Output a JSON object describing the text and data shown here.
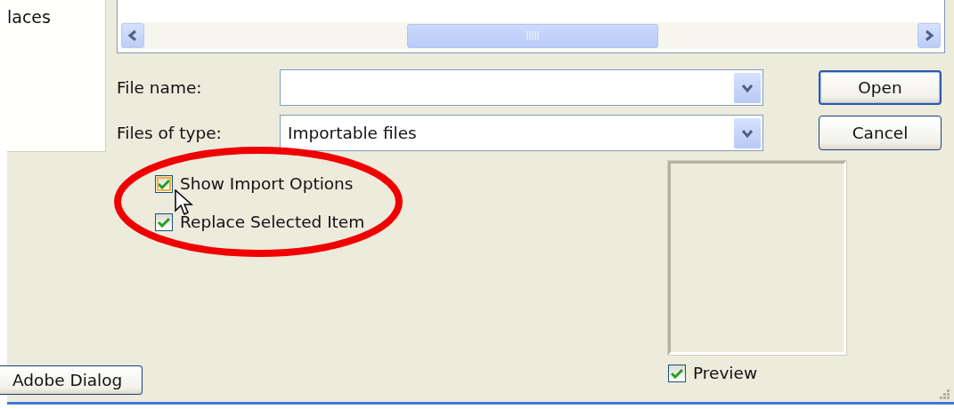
{
  "places": {
    "label": "laces"
  },
  "fields": [
    {
      "label": "File name:"
    },
    {
      "label": "Files of type:",
      "value": "Importable files"
    }
  ],
  "buttons": [
    {
      "label": "Open",
      "default": true
    },
    {
      "label": "Cancel",
      "default": false
    }
  ],
  "options": [
    {
      "label": "Show Import Options",
      "checked": true,
      "hovered": true
    },
    {
      "label": "Replace Selected Item",
      "checked": true,
      "hovered": false
    }
  ],
  "preview": {
    "label": "Preview",
    "checked": true
  },
  "dialog_button": {
    "label": "Adobe Dialog"
  }
}
